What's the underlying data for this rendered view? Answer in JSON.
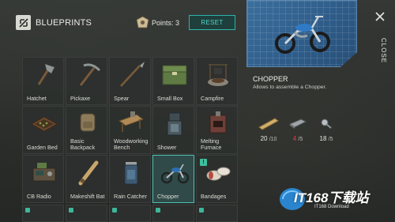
{
  "header": {
    "title": "BLUEPRINTS",
    "points_text": "Points: 3",
    "reset_label": "RESET",
    "close_label": "CLOSE"
  },
  "grid": {
    "items": [
      {
        "label": "Hatchet",
        "icon": "hatchet-icon"
      },
      {
        "label": "Pickaxe",
        "icon": "pickaxe-icon"
      },
      {
        "label": "Spear",
        "icon": "spear-icon"
      },
      {
        "label": "Small Box",
        "icon": "small-box-icon"
      },
      {
        "label": "Campfire",
        "icon": "campfire-icon"
      },
      {
        "label": "Garden Bed",
        "icon": "garden-bed-icon"
      },
      {
        "label": "Basic Backpack",
        "icon": "backpack-icon"
      },
      {
        "label": "Woodworking Bench",
        "icon": "woodworking-bench-icon"
      },
      {
        "label": "Shower",
        "icon": "shower-icon"
      },
      {
        "label": "Melting Furnace",
        "icon": "furnace-icon"
      },
      {
        "label": "CB Radio",
        "icon": "radio-icon"
      },
      {
        "label": "Makeshift Bat",
        "icon": "bat-icon"
      },
      {
        "label": "Rain Catcher",
        "icon": "rain-catcher-icon"
      },
      {
        "label": "Chopper",
        "icon": "motorcycle-icon",
        "selected": true
      },
      {
        "label": "Bandages",
        "icon": "bandages-icon"
      }
    ]
  },
  "details": {
    "name": "CHOPPER",
    "description": "Allows to assemble a Chopper.",
    "resources": [
      {
        "icon": "wood-plank-icon",
        "have": "20",
        "need": "/10",
        "low": false
      },
      {
        "icon": "metal-bar-icon",
        "have": "4",
        "need": "/5",
        "low": true
      },
      {
        "icon": "bolts-icon",
        "have": "18",
        "need": "/5",
        "low": false
      }
    ]
  },
  "watermark": {
    "text": "IT168下载站",
    "sub": "IT168 Download"
  },
  "colors": {
    "accent": "#2fb3a8",
    "blueprint": "#3b6f9d",
    "insufficient": "#e0453e"
  }
}
